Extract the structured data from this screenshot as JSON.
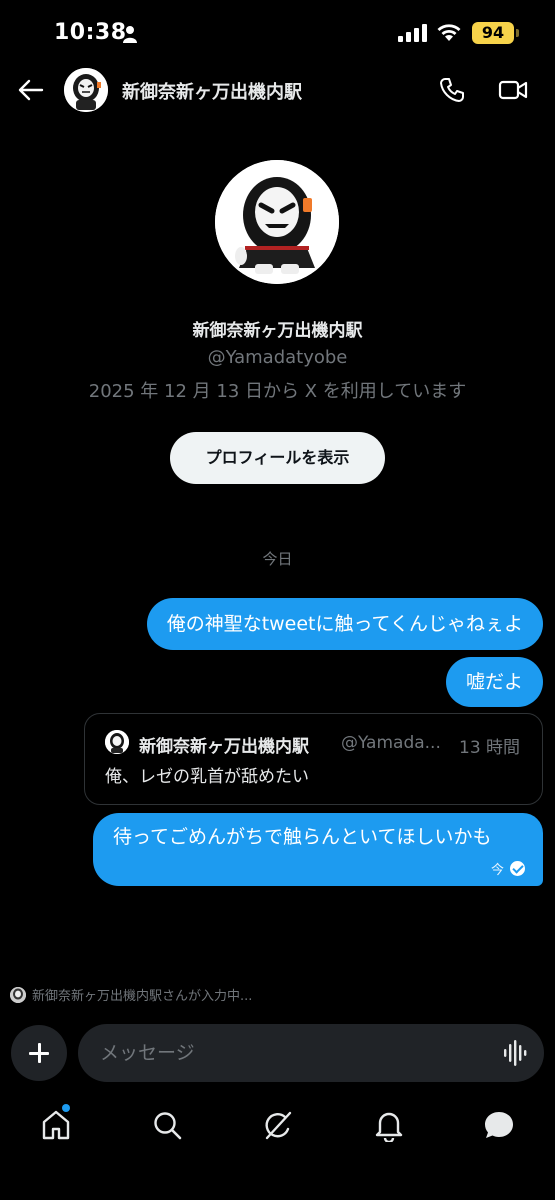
{
  "status_bar": {
    "time": "10:38",
    "battery": "94",
    "battery_color": "#f7d34a"
  },
  "header": {
    "back_icon": "arrow-left-icon",
    "title": "新御奈新ヶ万出機内駅",
    "call_icon": "phone-icon",
    "video_icon": "video-camera-icon"
  },
  "profile": {
    "name": "新御奈新ヶ万出機内駅",
    "handle": "@Yamadatyobe",
    "joined": "2025 年 12 月 13 日から X を利用しています",
    "view_profile_label": "プロフィールを表示"
  },
  "conversation": {
    "date_divider": "今日",
    "messages": [
      {
        "text": "俺の神聖なtweetに触ってくんじゃねぇよ"
      },
      {
        "text": "嘘だよ"
      },
      {
        "text": "待ってごめんがちで触らんといてほしいかも",
        "time": "今",
        "status_icon": "read-check-icon"
      }
    ],
    "quote": {
      "name": "新御奈新ヶ万出機内駅",
      "handle": "@Yamada...",
      "time": "13 時間",
      "text": "俺、レゼの乳首が舐めたい"
    }
  },
  "typing_indicator": "新御奈新ヶ万出機内駅さんが入力中...",
  "composer": {
    "placeholder": "メッセージ",
    "add_icon": "plus-icon",
    "voice_icon": "waveform-icon"
  },
  "tabs": [
    {
      "icon": "home-icon",
      "has_badge": true
    },
    {
      "icon": "search-icon"
    },
    {
      "icon": "grok-icon"
    },
    {
      "icon": "bell-icon"
    },
    {
      "icon": "message-bubble-icon"
    }
  ],
  "colors": {
    "accent": "#1d9bf0",
    "background": "#000000",
    "secondary_text": "#71767b",
    "button_bg": "#eff3f4"
  }
}
